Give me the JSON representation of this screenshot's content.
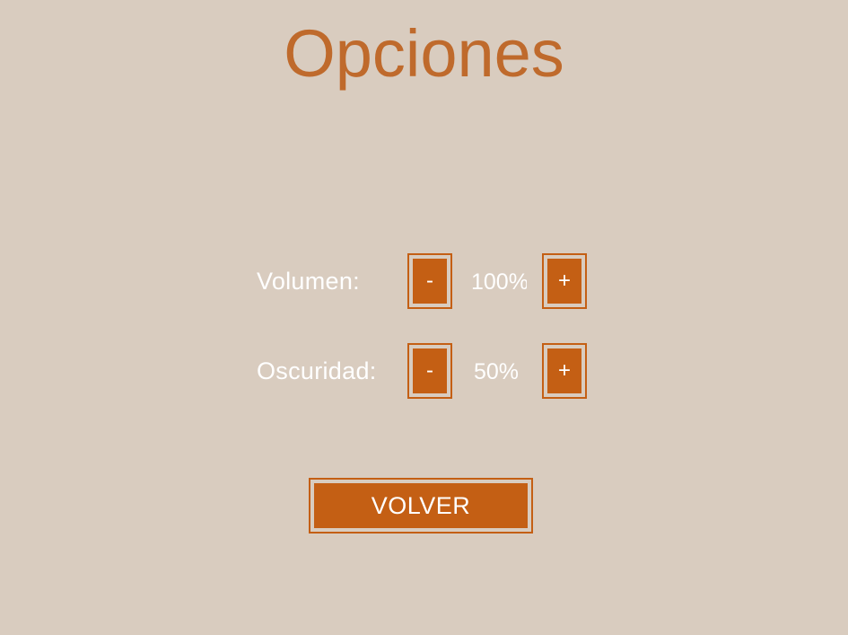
{
  "screen": {
    "title": "Opciones"
  },
  "options": {
    "volume": {
      "label": "Volumen:",
      "value": "100%",
      "decrease_label": "-",
      "increase_label": "+"
    },
    "darkness": {
      "label": "Oscuridad:",
      "value": "50%",
      "decrease_label": "-",
      "increase_label": "+"
    }
  },
  "footer": {
    "back_label": "VOLVER"
  },
  "colors": {
    "background": "#d9ccbf",
    "accent": "#c45f14",
    "title": "#bf6a2c",
    "text": "#ffffff"
  }
}
